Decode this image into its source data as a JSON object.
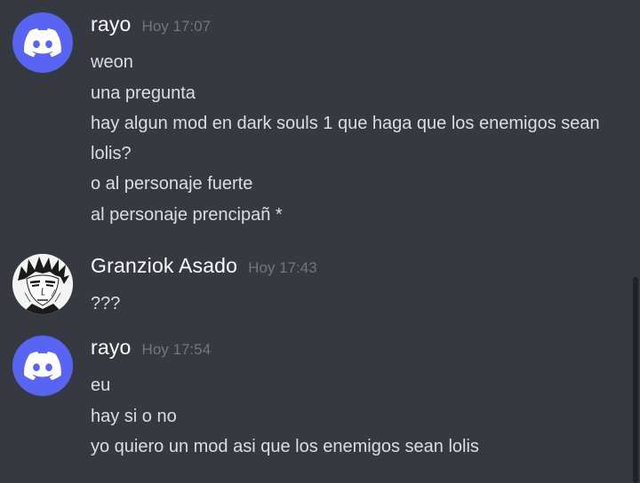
{
  "messages": [
    {
      "username": "rayo",
      "timestamp": "Hoy 17:07",
      "avatar": "discord-default-avatar",
      "lines": [
        "weon",
        "una pregunta",
        "hay algun mod en dark souls 1 que haga que los enemigos sean lolis?",
        "o al personaje fuerte",
        "al personaje prencipañ *"
      ]
    },
    {
      "username": "Granziok Asado",
      "timestamp": "Hoy 17:43",
      "avatar": "manga-portrait-avatar",
      "lines": [
        "???"
      ]
    },
    {
      "username": "rayo",
      "timestamp": "Hoy 17:54",
      "avatar": "discord-default-avatar",
      "lines": [
        "eu",
        "hay si o no",
        "yo quiero un mod asi que los enemigos sean lolis"
      ]
    }
  ],
  "colors": {
    "background": "#36393f",
    "blurple": "#5865f2",
    "username": "#ffffff",
    "timestamp": "#72767d",
    "text": "#dcddde"
  }
}
